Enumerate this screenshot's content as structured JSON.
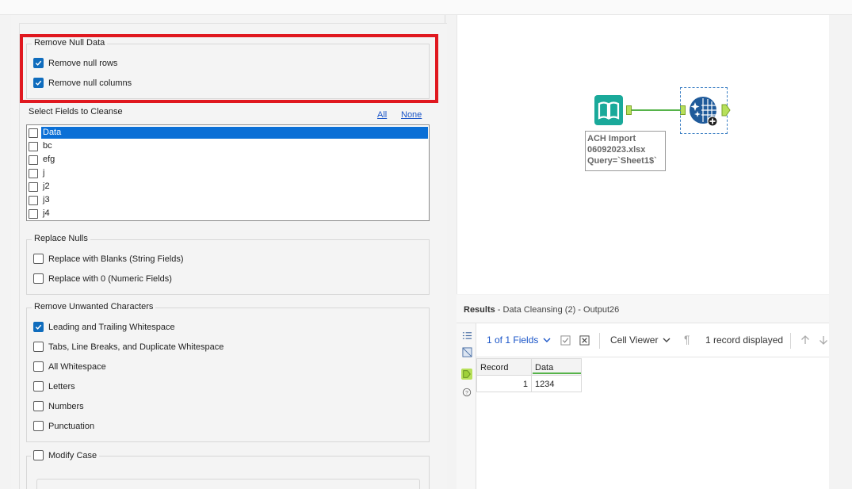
{
  "remove_null": {
    "title": "Remove Null Data",
    "options": [
      {
        "label": "Remove null rows",
        "checked": true
      },
      {
        "label": "Remove null columns",
        "checked": true
      }
    ]
  },
  "fields": {
    "label": "Select Fields to Cleanse",
    "all_link": "All",
    "none_link": "None",
    "items": [
      {
        "name": "Data",
        "checked": false,
        "selected": true
      },
      {
        "name": "bc",
        "checked": false
      },
      {
        "name": "efg",
        "checked": false
      },
      {
        "name": "j",
        "checked": false
      },
      {
        "name": "j2",
        "checked": false
      },
      {
        "name": "j3",
        "checked": false
      },
      {
        "name": "j4",
        "checked": false
      }
    ]
  },
  "replace_nulls": {
    "title": "Replace Nulls",
    "options": [
      {
        "label": "Replace with Blanks (String Fields)",
        "checked": false
      },
      {
        "label": "Replace with 0 (Numeric Fields)",
        "checked": false
      }
    ]
  },
  "unwanted_chars": {
    "title": "Remove Unwanted Characters",
    "options": [
      {
        "label": "Leading and Trailing Whitespace",
        "checked": true
      },
      {
        "label": "Tabs, Line Breaks, and Duplicate Whitespace",
        "checked": false
      },
      {
        "label": "All Whitespace",
        "checked": false
      },
      {
        "label": "Letters",
        "checked": false
      },
      {
        "label": "Numbers",
        "checked": false
      },
      {
        "label": "Punctuation",
        "checked": false
      }
    ]
  },
  "modify_case": {
    "label": "Modify Case",
    "checked": false
  },
  "canvas": {
    "input_annotation": {
      "line1": "ACH Import",
      "line2": "06092023.xlsx",
      "line3": "Query=`Sheet1$`"
    }
  },
  "results": {
    "title": "Results",
    "subtitle": " - Data Cleansing (2) - Output26",
    "fields_selector": "1 of 1 Fields",
    "viewer": "Cell Viewer",
    "record_count": "1 record displayed",
    "columns": [
      "Record",
      "Data"
    ],
    "rows": [
      [
        "1",
        "1234"
      ]
    ]
  },
  "colors": {
    "accent": "#0f6cbd",
    "highlight": "#e0181f",
    "connection": "#56b34a"
  }
}
